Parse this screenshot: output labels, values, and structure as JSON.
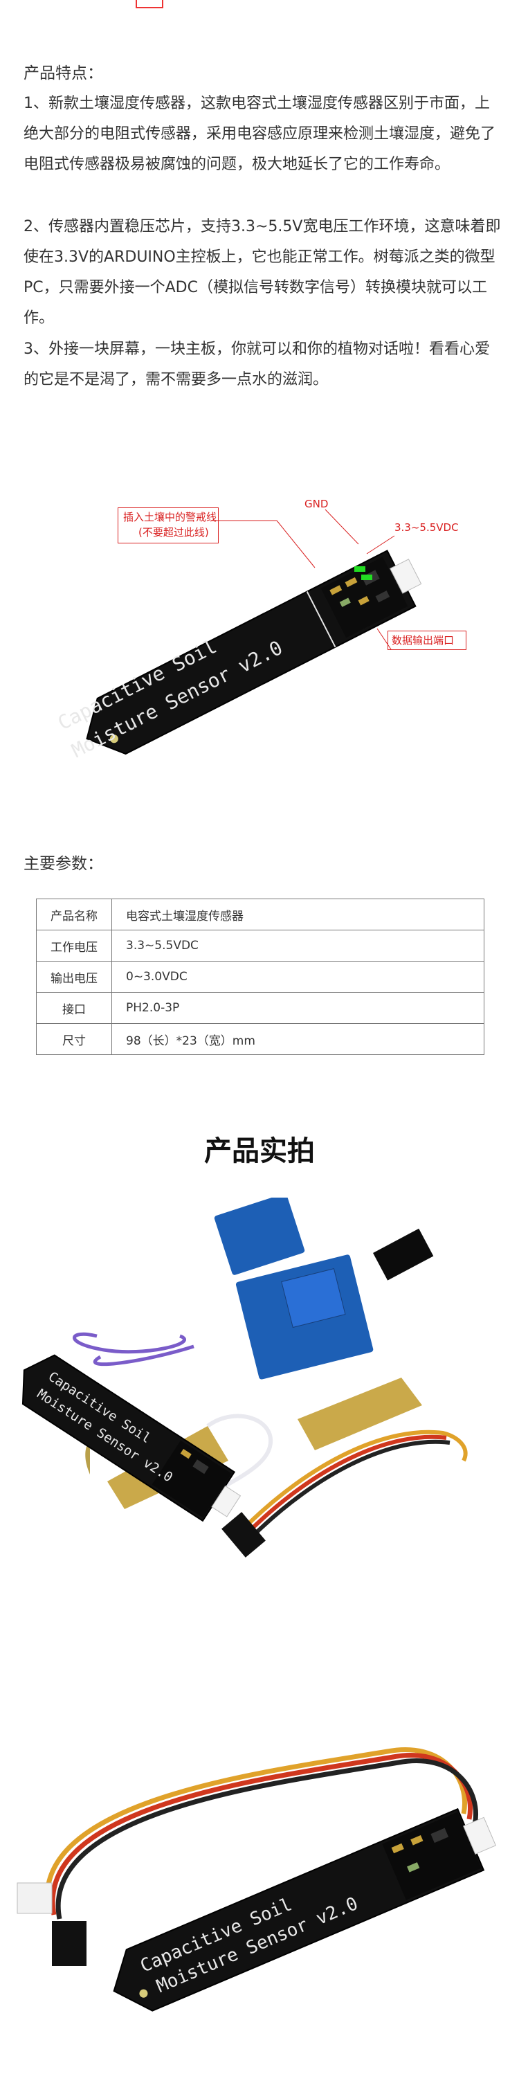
{
  "features": {
    "heading": "产品特点：",
    "items": [
      "1、新款土壤湿度传感器，这款电容式土壤湿度传感器区别于市面，上绝大部分的电阻式传感器，采用电容感应原理来检测土壤湿度，避免了电阻式传感器极易被腐蚀的问题，极大地延长了它的工作寿命。",
      "2、传感器内置稳压芯片，支持3.3~5.5V宽电压工作环境，这意味着即使在3.3V的ARDUINO主控板上，它也能正常工作。树莓派之类的微型PC，只需要外接一个ADC（模拟信号转数字信号）转换模块就可以工作。",
      "3、外接一块屏幕，一块主板，你就可以和你的植物对话啦！看看心爱的它是不是渴了，需不需要多一点水的滋润。"
    ]
  },
  "diagram": {
    "warning_line_label": "插入土壤中的警戒线",
    "warning_line_sub": "(不要超过此线)",
    "gnd_label": "GND",
    "vcc_label": "3.3~5.5VDC",
    "output_label": "数据输出端口",
    "board_text_1": "Capacitive Soil",
    "board_text_2": "Moisture Sensor v2.0"
  },
  "params": {
    "heading": "主要参数：",
    "rows": [
      {
        "key": "产品名称",
        "value": "电容式土壤湿度传感器"
      },
      {
        "key": "工作电压",
        "value": "3.3~5.5VDC"
      },
      {
        "key": "输出电压",
        "value": "0~3.0VDC"
      },
      {
        "key": "接口",
        "value": "PH2.0-3P"
      },
      {
        "key": "尺寸",
        "value": "98（长）*23（宽）mm"
      }
    ]
  },
  "photos": {
    "title": "产品实拍",
    "board_text_1": "Capacitive Soil",
    "board_text_2": "Moisture Sensor v2.0"
  }
}
